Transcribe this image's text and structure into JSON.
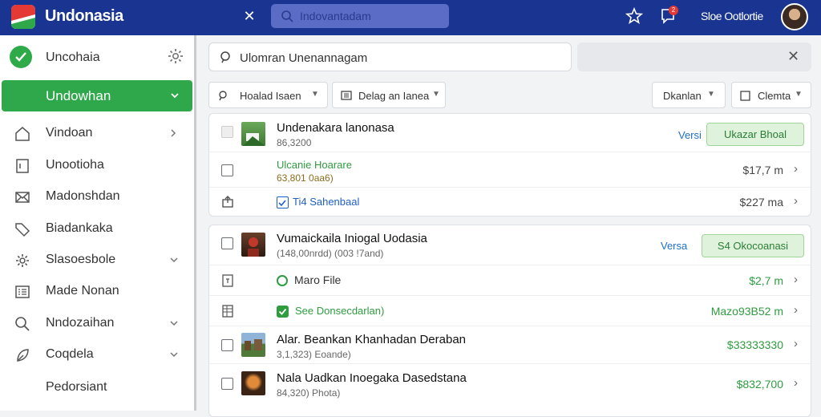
{
  "topbar": {
    "app_title": "Undonasia",
    "search_placeholder": "Indovantadam",
    "notif_count": "2",
    "user_name": "Sloe Ootlortie"
  },
  "sidebar": {
    "header_label": "Uncohaia",
    "active_label": "Undowhan",
    "items": [
      {
        "label": "Vindoan",
        "icon": "home-icon",
        "chevron": true
      },
      {
        "label": "Unootioha",
        "icon": "document-icon",
        "chevron": false
      },
      {
        "label": "Madonshdan",
        "icon": "envelope-icon",
        "chevron": false
      },
      {
        "label": "Biadankaka",
        "icon": "tag-icon",
        "chevron": false
      },
      {
        "label": "Slasoesbole",
        "icon": "gear-icon",
        "chevron": true
      },
      {
        "label": "Made Nonan",
        "icon": "list-icon",
        "chevron": false
      },
      {
        "label": "Nndozaihan",
        "icon": "search-icon",
        "chevron": true
      },
      {
        "label": "Coqdela",
        "icon": "leaf-icon",
        "chevron": true
      },
      {
        "label": "Pedorsiant",
        "icon": "",
        "chevron": false
      }
    ]
  },
  "main": {
    "search_value": "Ulomran Unenannagam",
    "filters": {
      "f1": "Hoalad Isaen",
      "f2": "Delag an Ianea",
      "f3": "Dkanlan",
      "f4": "Clemta"
    },
    "card1": {
      "r1_title": "Undenakara lanonasa",
      "r1_sub": "86,3200",
      "r1_versi": "Versi",
      "r1_button": "Ukazar Bhoal",
      "r2_title": "Ulcanie Hoarare",
      "r2_sub": "63,801 0aa6)",
      "r2_price": "$17,7 m",
      "r3_title": "Ti4 Sahenbaal",
      "r3_price": "$227 ma"
    },
    "card2": {
      "r1_title": "Vumaickaila Iniogal Uodasia",
      "r1_sub": "(148,00nrdd) (003 !7and)",
      "r1_versi": "Versa",
      "r1_button": "S4 Okocoanasi",
      "r2_title": "Maro File",
      "r2_price": "$2,7 m",
      "r3_title": "See Donsecdarlan)",
      "r3_price": "Mazo93B52 m",
      "r4_title": "Alar. Beankan Khanhadan Deraban",
      "r4_sub": "3,1,323) Eoande)",
      "r4_price": "$33333330",
      "r5_title": "Nala Uadkan Inoegaka Dasedstana",
      "r5_sub": "84,320) Phota)",
      "r5_price": "$832,700"
    }
  }
}
